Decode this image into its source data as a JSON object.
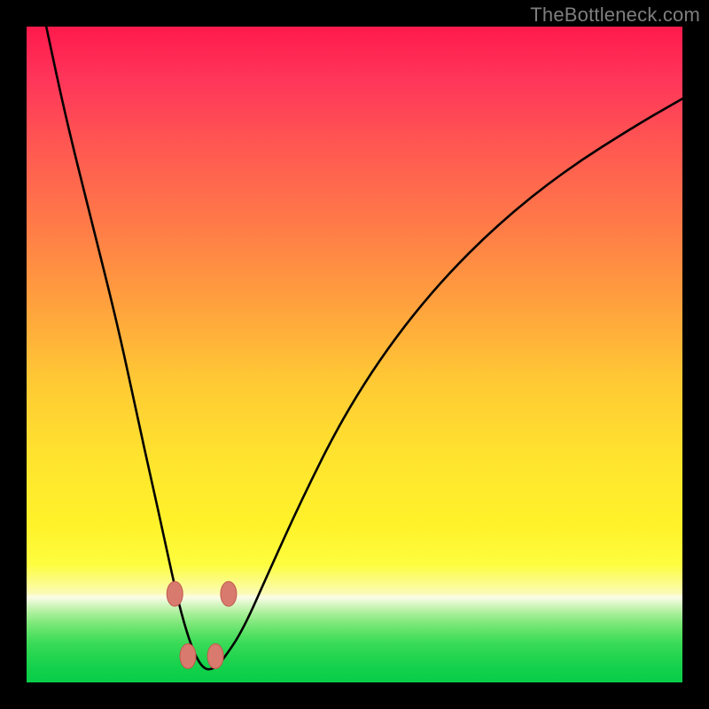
{
  "watermark": "TheBottleneck.com",
  "chart_data": {
    "type": "line",
    "title": "",
    "xlabel": "",
    "ylabel": "",
    "x_range": [
      0,
      100
    ],
    "y_range": [
      0,
      100
    ],
    "series": [
      {
        "name": "bottleneck-curve",
        "x": [
          3,
          6,
          10,
          14,
          17,
          19,
          21,
          22.5,
          24,
          25.5,
          27,
          28.5,
          30,
          33,
          37,
          42,
          48,
          55,
          63,
          72,
          82,
          93,
          100
        ],
        "y": [
          100,
          86,
          70,
          54,
          40,
          31,
          22,
          15,
          9,
          4.5,
          2,
          2,
          3.5,
          8,
          17,
          28,
          40,
          51,
          61,
          70,
          78,
          85,
          89
        ]
      }
    ],
    "markers": [
      {
        "name": "marker-left-upper",
        "x": 22.6,
        "y": 13.5
      },
      {
        "name": "marker-left-lower",
        "x": 24.6,
        "y": 4.0
      },
      {
        "name": "marker-right-lower",
        "x": 28.8,
        "y": 4.0
      },
      {
        "name": "marker-right-upper",
        "x": 30.8,
        "y": 13.5
      }
    ],
    "colors": {
      "curve": "#000000",
      "marker_fill": "#d97a6e",
      "marker_stroke": "#c05a4e"
    }
  }
}
